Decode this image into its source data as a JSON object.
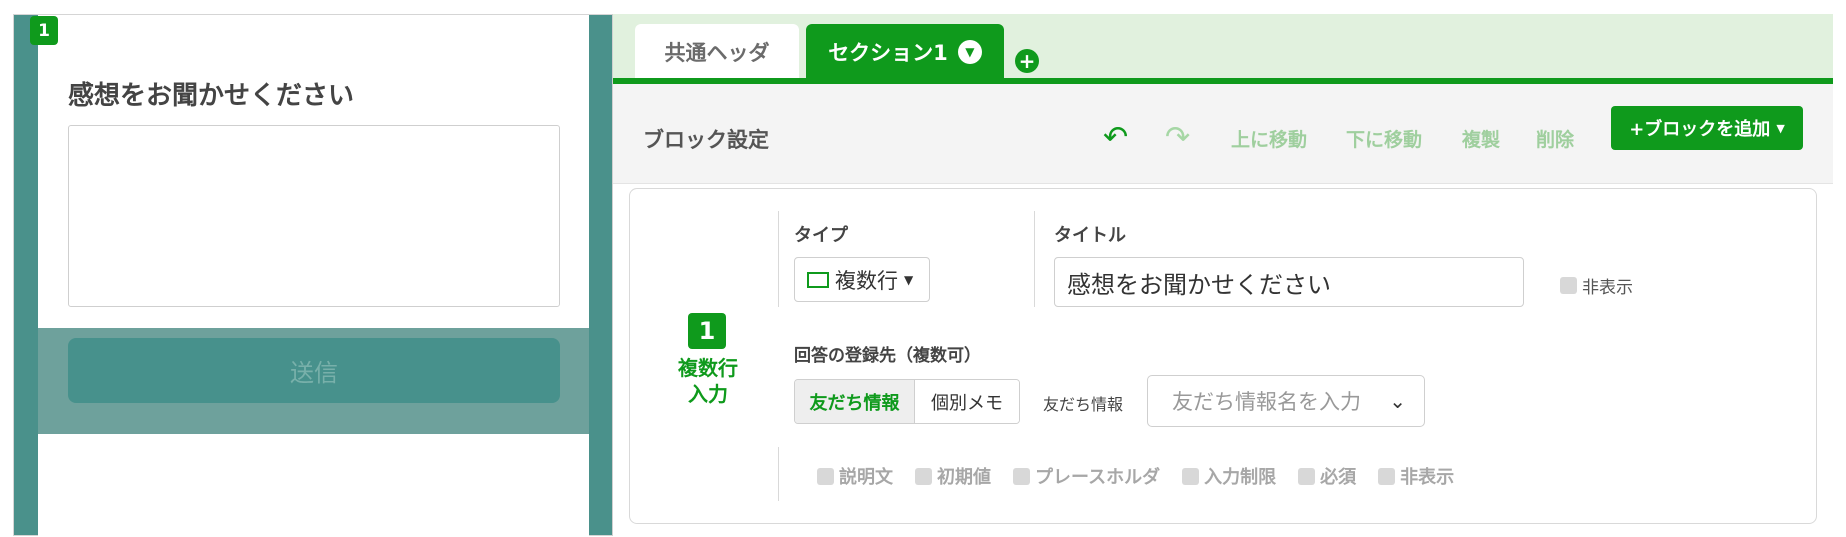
{
  "preview": {
    "badge": "1",
    "question_title": "感想をお聞かせください",
    "submit_label": "送信"
  },
  "tabs": {
    "common": "共通ヘッダ",
    "section": "セクション1",
    "add_icon": "plus-icon"
  },
  "toolbar": {
    "title": "ブロック設定",
    "move_up": "上に移動",
    "move_down": "下に移動",
    "duplicate": "複製",
    "delete": "削除",
    "add_block": "+ブロックを追加"
  },
  "block": {
    "number": "1",
    "type_line1": "複数行",
    "type_line2": "入力",
    "type_label": "タイプ",
    "type_value": "複数行",
    "title_label": "タイトル",
    "title_value": "感想をお聞かせください",
    "hide_label": "非表示",
    "destination_label": "回答の登録先（複数可）",
    "dest_friend_info": "友だち情報",
    "dest_memo": "個別メモ",
    "friend_info_label": "友だち情報",
    "friend_info_placeholder": "友だち情報名を入力",
    "options": [
      "説明文",
      "初期値",
      "プレースホルダ",
      "入力制限",
      "必須",
      "非表示"
    ]
  },
  "colors": {
    "accent": "#0f9a1c",
    "preview_frame": "#4a918b",
    "tab_bar": "#e1f1de"
  }
}
